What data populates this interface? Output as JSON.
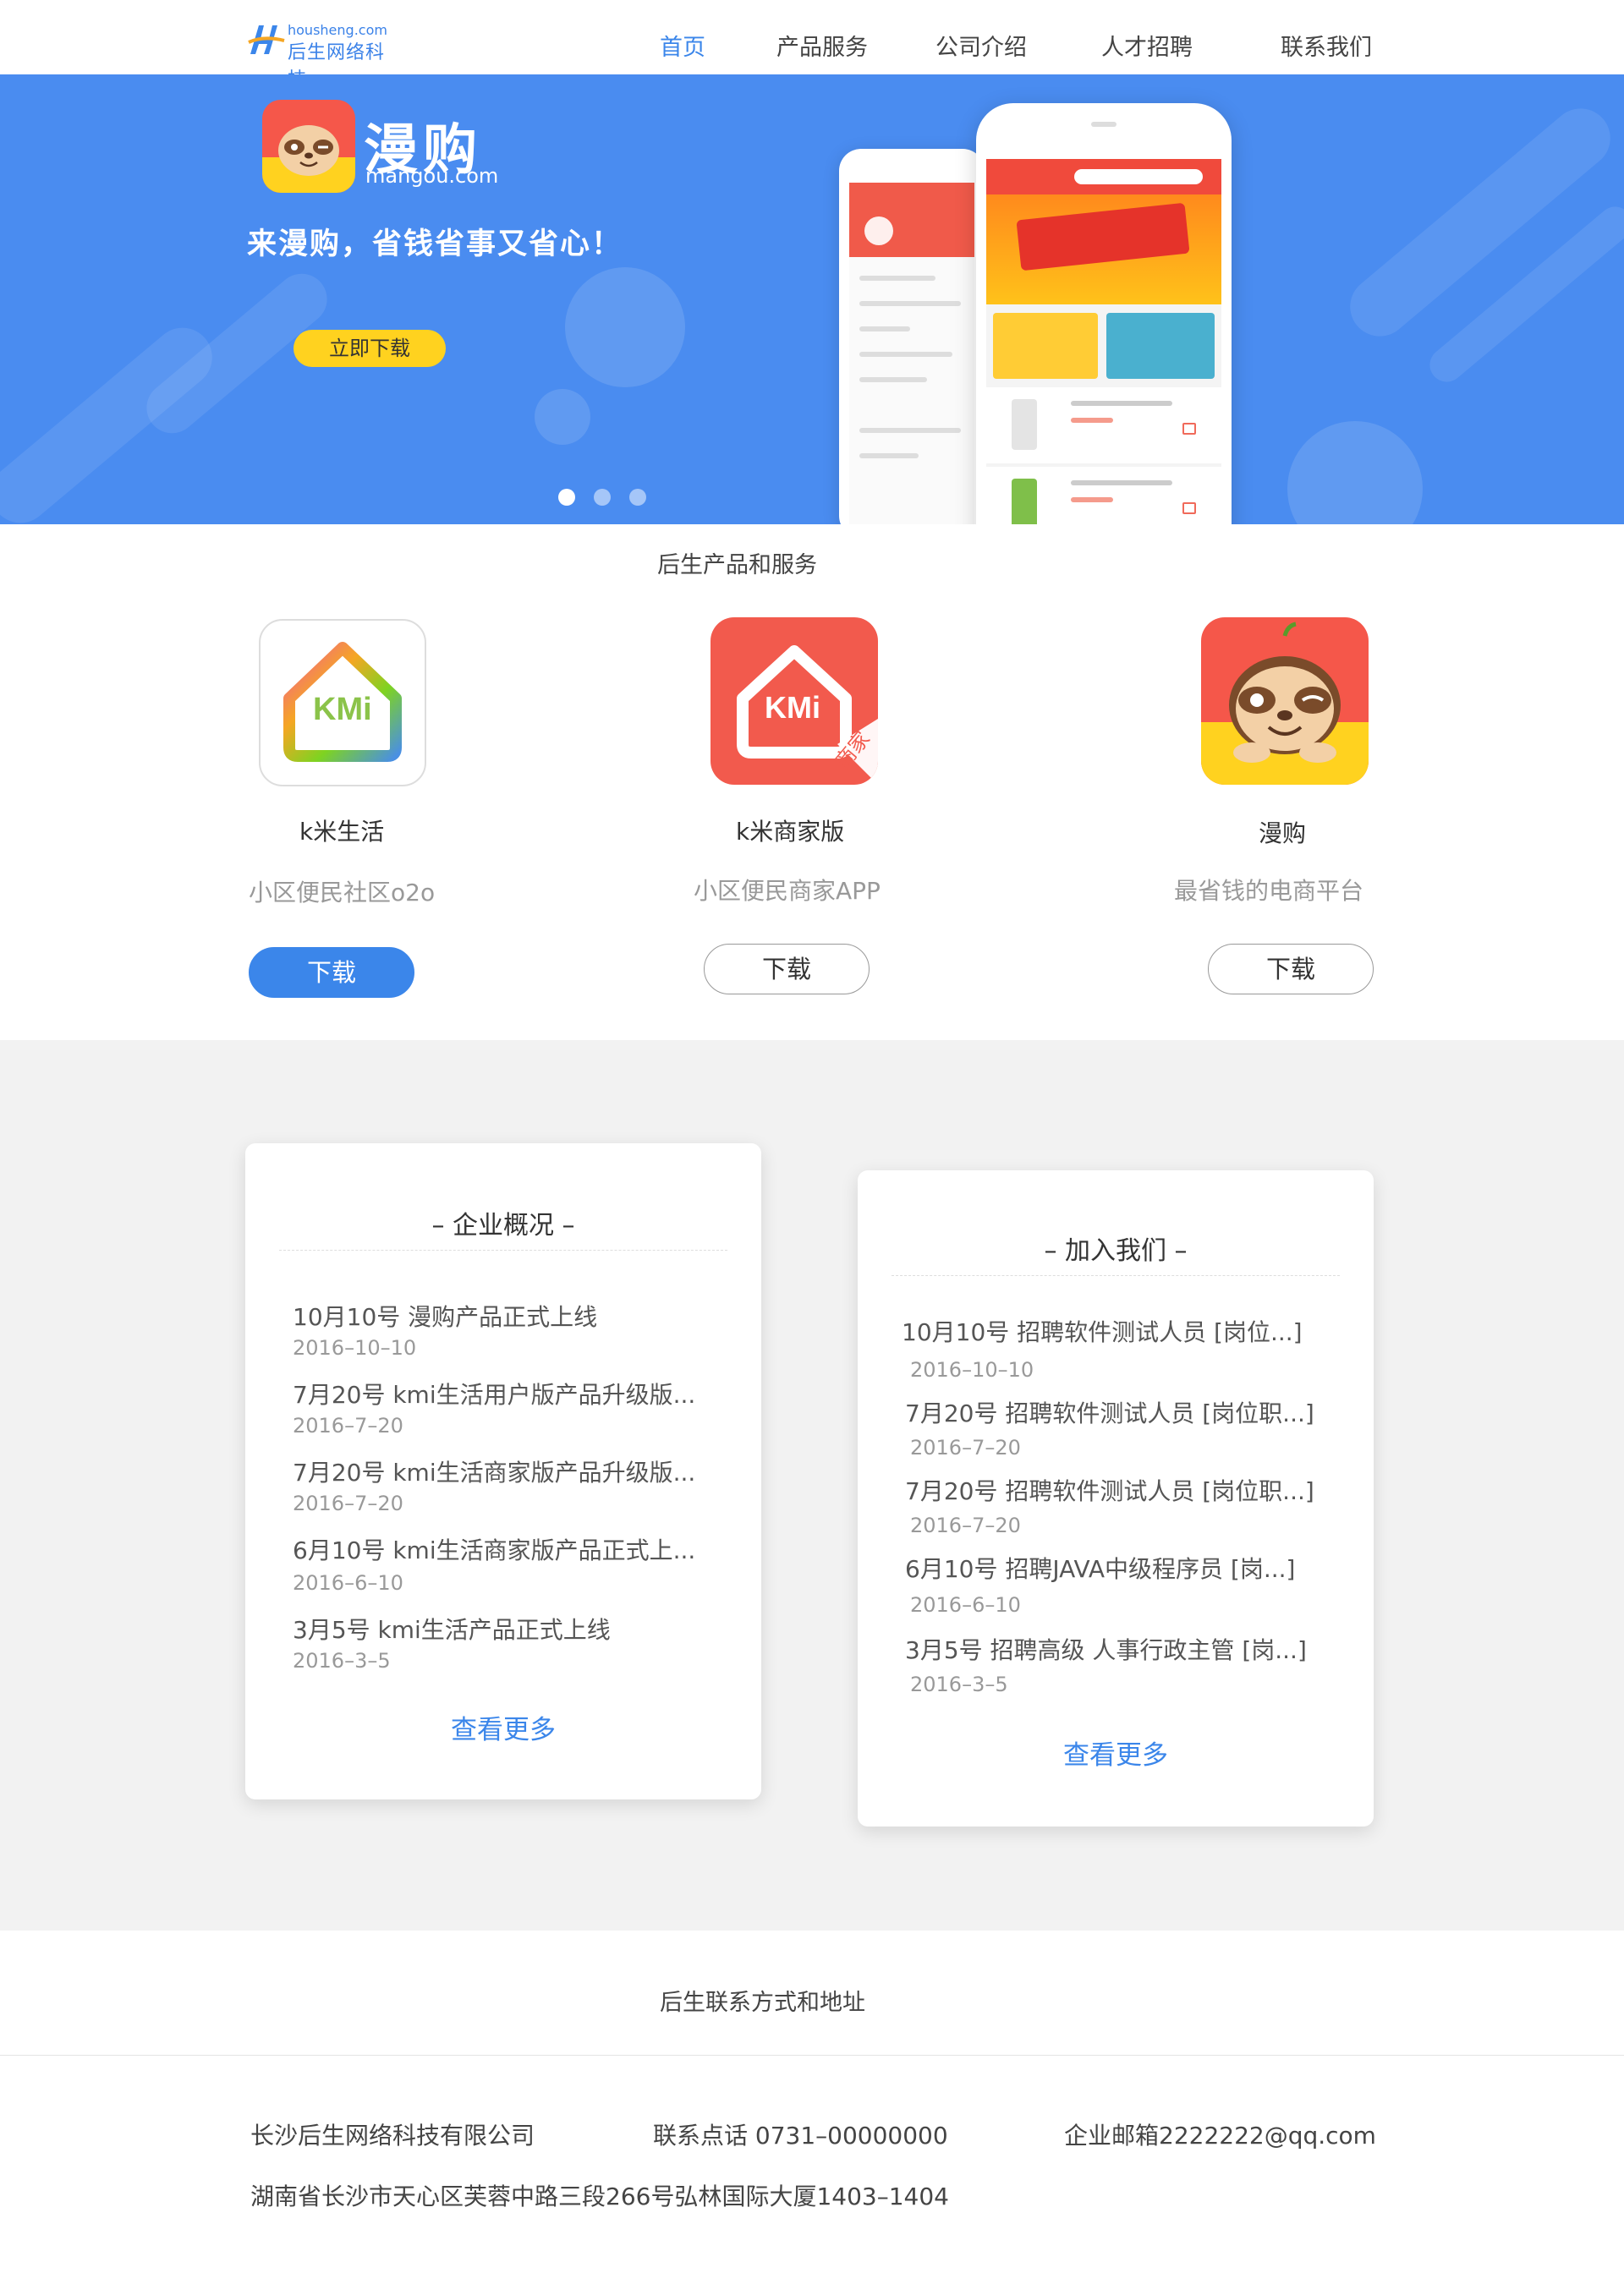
{
  "header": {
    "logo": {
      "domain": "housheng.com",
      "company": "后生网络科技"
    },
    "nav": [
      {
        "label": "首页",
        "active": true
      },
      {
        "label": "产品服务",
        "active": false
      },
      {
        "label": "公司介绍",
        "active": false
      },
      {
        "label": "人才招聘",
        "active": false
      },
      {
        "label": "联系我们",
        "active": false
      }
    ]
  },
  "banner": {
    "brand_name": "漫购",
    "brand_url": "mangou.com",
    "slogan": "来漫购，省钱省事又省心！",
    "download_label": "立即下载",
    "slides_total": 3,
    "slide_active": 1,
    "background_color": "#4a8cf0"
  },
  "products": {
    "title": "后生产品和服务",
    "items": [
      {
        "name": "k米生活",
        "desc": "小区便民社区o2o",
        "button": "下载",
        "icon": "kmi-house-icon",
        "icon_text": "KMi"
      },
      {
        "name": "k米商家版",
        "desc": "小区便民商家APP",
        "button": "下载",
        "icon": "kmi-shop-icon",
        "icon_text": "KMi",
        "ribbon": "商家"
      },
      {
        "name": "漫购",
        "desc": "最省钱的电商平台",
        "button": "下载",
        "icon": "mangou-sloth-icon"
      }
    ]
  },
  "news": {
    "title": "– 企业概况 –",
    "items": [
      {
        "title": "10月10号  漫购产品正式上线",
        "date": "2016–10–10"
      },
      {
        "title": "7月20号  kmi生活用户版产品升级版...",
        "date": "2016–7–20"
      },
      {
        "title": "7月20号  kmi生活商家版产品升级版...",
        "date": "2016–7–20"
      },
      {
        "title": "6月10号  kmi生活商家版产品正式上...",
        "date": "2016–6–10"
      },
      {
        "title": "3月5号  kmi生活产品正式上线",
        "date": "2016–3–5"
      }
    ],
    "more": "查看更多"
  },
  "jobs": {
    "title": "– 加入我们 –",
    "items": [
      {
        "title": "10月10号  招聘软件测试人员 [岗位...]",
        "date": "2016–10–10"
      },
      {
        "title": "7月20号  招聘软件测试人员 [岗位职...]",
        "date": "2016–7–20"
      },
      {
        "title": "7月20号  招聘软件测试人员 [岗位职...]",
        "date": "2016–7–20"
      },
      {
        "title": "6月10号  招聘JAVA中级程序员 [岗...]",
        "date": "2016–6–10"
      },
      {
        "title": "3月5号  招聘高级 人事行政主管 [岗...]",
        "date": "2016–3–5"
      }
    ],
    "more": "查看更多"
  },
  "contact": {
    "title": "后生联系方式和地址",
    "company": "长沙后生网络科技有限公司",
    "phone": "联系点话  0731–00000000",
    "email": "企业邮箱2222222@qq.com",
    "address": "湖南省长沙市天心区芙蓉中路三段266号弘林国际大厦1403–1404"
  },
  "colors": {
    "accent": "#3b86ea",
    "banner": "#4a8cf0",
    "yellow": "#ffd21f",
    "brand_red": "#f5574a"
  }
}
